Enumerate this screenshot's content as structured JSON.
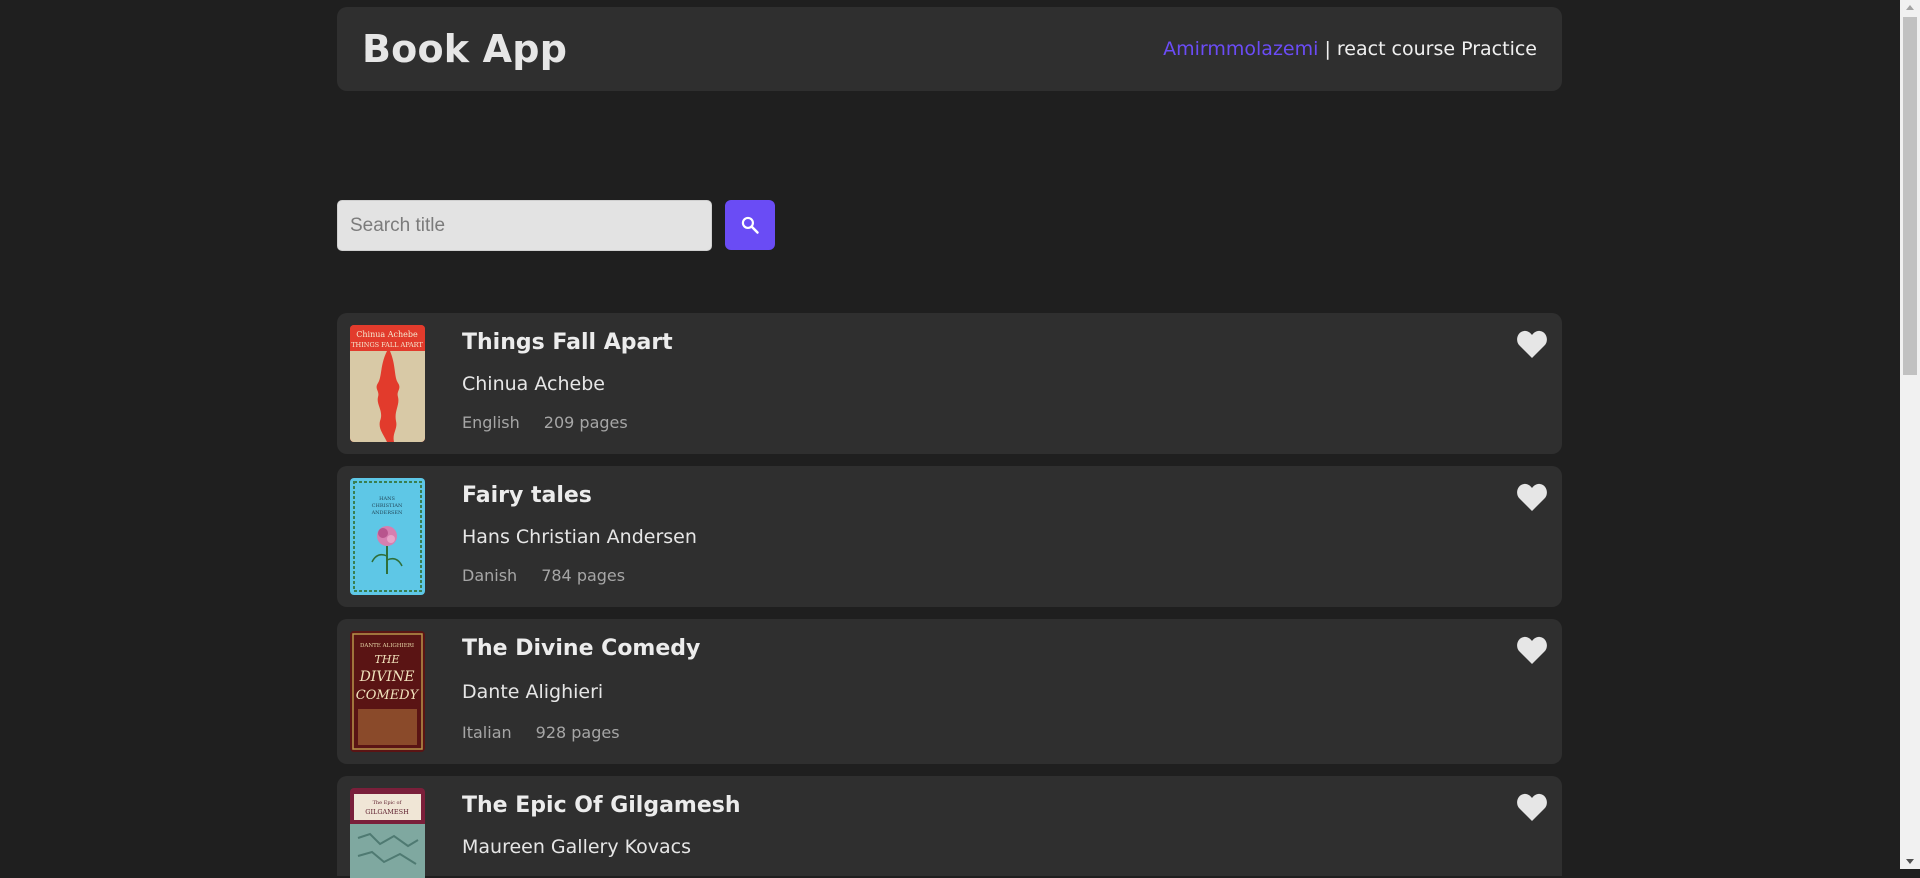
{
  "header": {
    "app_title": "Book App",
    "author_link": "Amirmmolazemi",
    "separator": " | ",
    "tagline": "react course Practice"
  },
  "search": {
    "placeholder": "Search title",
    "value": "",
    "button_icon": "search-icon"
  },
  "books": [
    {
      "title": "Things Fall Apart",
      "author": "Chinua Achebe",
      "language": "English",
      "pages": "209 pages",
      "cover_lines": [
        "Chinua Achebe",
        "THINGS FALL APART"
      ]
    },
    {
      "title": "Fairy tales",
      "author": "Hans Christian Andersen",
      "language": "Danish",
      "pages": "784 pages",
      "cover_lines": [
        "HANS",
        "CHRISTIAN",
        "ANDERSEN"
      ]
    },
    {
      "title": "The Divine Comedy",
      "author": "Dante Alighieri",
      "language": "Italian",
      "pages": "928 pages",
      "cover_lines": [
        "DANTE ALIGHIERI",
        "THE",
        "DIVINE",
        "COMEDY"
      ]
    },
    {
      "title": "The Epic Of Gilgamesh",
      "author": "Maureen Gallery Kovacs",
      "language": "",
      "pages": "",
      "cover_lines": [
        "The Epic of",
        "GILGAMESH"
      ]
    }
  ],
  "colors": {
    "background": "#1f1f1f",
    "card": "#2f2f2f",
    "accent": "#6a4cf5",
    "heart": "#e6e6e6"
  }
}
